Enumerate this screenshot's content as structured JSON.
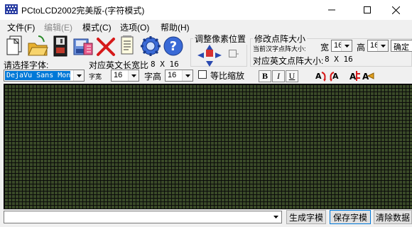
{
  "window": {
    "title": "PCtoLCD2002完美版-(字符模式)"
  },
  "menu": [
    {
      "label": "文件(F)",
      "enabled": true
    },
    {
      "label": "编辑(E)",
      "enabled": false
    },
    {
      "label": "模式(C)",
      "enabled": true
    },
    {
      "label": "选项(O)",
      "enabled": true
    },
    {
      "label": "帮助(H)",
      "enabled": true
    }
  ],
  "toolbar": {
    "icons": [
      "new-document-icon",
      "open-folder-icon",
      "save-disk-icon",
      "save-as-icon",
      "delete-x-icon",
      "notepad-icon",
      "settings-gear-icon",
      "help-question-icon"
    ]
  },
  "pixel_adjust": {
    "title": "调整像素位置"
  },
  "size_group": {
    "title": "修改点阵大小",
    "current_label": "当前汉字点阵大小:",
    "width_label": "宽",
    "width_value": "16",
    "height_label": "高",
    "height_value": "16",
    "extra_value": "确定",
    "en_size_label": "对应英文点阵大小:",
    "en_size_value": "8 X 16"
  },
  "font_row": {
    "font_label": "请选择字体:",
    "en_width_label": "对应英文长宽比",
    "en_width_value": "8 X 16",
    "font_value": "DejaVu Sans Mono",
    "char_width_label": "字宽",
    "char_width_value": "16",
    "char_height_label": "字高",
    "char_height_value": "16",
    "proportional_label": "等比缩放",
    "bold_label": "B",
    "italic_label": "I",
    "underline_label": "U"
  },
  "bottom": {
    "input_value": "",
    "generate_label": "生成字模",
    "save_label": "保存字模",
    "clear_label": "清除数据"
  },
  "colors": {
    "grid_cell": "#3a4a28",
    "grid_line": "#0b0b0b",
    "selection": "#0078d7"
  }
}
